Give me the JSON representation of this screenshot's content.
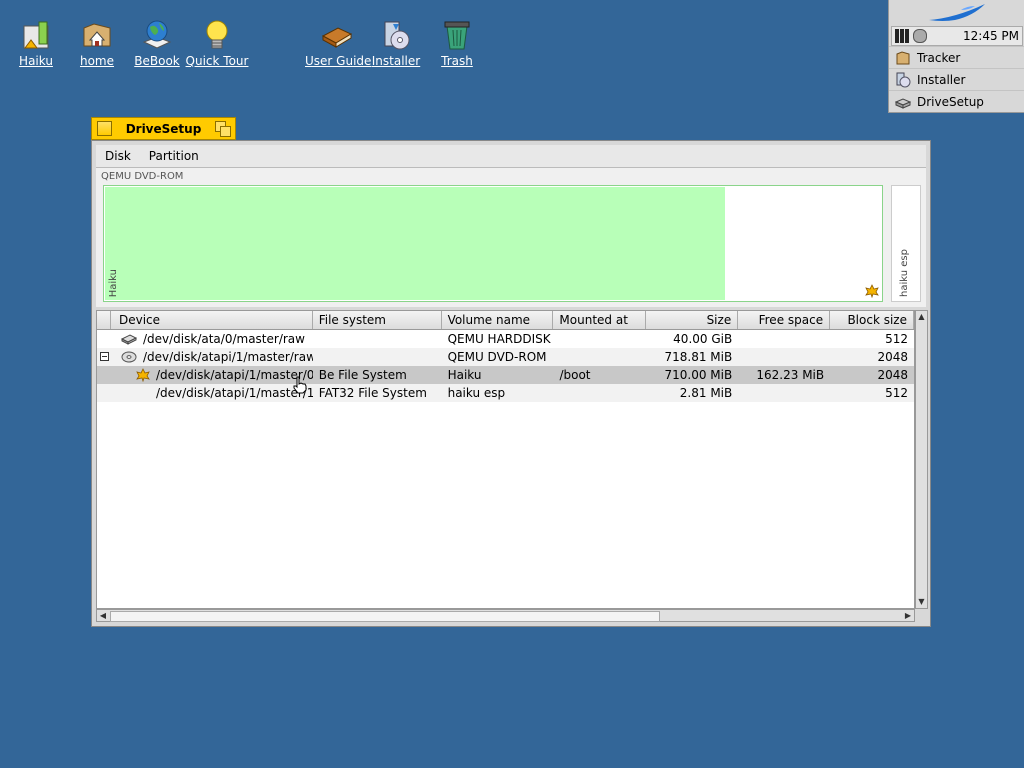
{
  "desktop": {
    "icons": [
      {
        "label": "Haiku",
        "icon": "haiku-volume-icon"
      },
      {
        "label": "home",
        "icon": "home-folder-icon"
      },
      {
        "label": "BeBook",
        "icon": "bebook-globe-icon"
      },
      {
        "label": "Quick Tour",
        "icon": "lightbulb-icon"
      },
      {
        "label": "User Guide",
        "icon": "book-icon"
      },
      {
        "label": "Installer",
        "icon": "installer-icon"
      },
      {
        "label": "Trash",
        "icon": "trash-icon"
      }
    ]
  },
  "deskbar": {
    "clock": "12:45 PM",
    "apps": [
      {
        "label": "Tracker",
        "icon": "tracker-icon"
      },
      {
        "label": "Installer",
        "icon": "installer-icon"
      },
      {
        "label": "DriveSetup",
        "icon": "drivesetup-icon"
      }
    ]
  },
  "window": {
    "title": "DriveSetup",
    "menu": [
      "Disk",
      "Partition"
    ],
    "disk_label": "QEMU DVD-ROM",
    "partitions": [
      {
        "label": "Haiku",
        "used_fraction": 0.8
      },
      {
        "label": "haiku esp"
      }
    ],
    "columns": [
      "Device",
      "File system",
      "Volume name",
      "Mounted at",
      "Size",
      "Free space",
      "Block size"
    ],
    "rows": [
      {
        "device": "/dev/disk/ata/0/master/raw",
        "fs": "",
        "volume": "QEMU HARDDISK",
        "mount": "",
        "size": "40.00 GiB",
        "free": "",
        "block": "512",
        "icon": "harddisk-icon"
      },
      {
        "device": "/dev/disk/atapi/1/master/raw",
        "fs": "",
        "volume": "QEMU DVD-ROM",
        "mount": "",
        "size": "718.81 MiB",
        "free": "",
        "block": "2048",
        "icon": "cdrom-icon"
      },
      {
        "device": "/dev/disk/atapi/1/master/0",
        "fs": "Be File System",
        "volume": "Haiku",
        "mount": "/boot",
        "size": "710.00 MiB",
        "free": "162.23 MiB",
        "block": "2048",
        "icon": "haiku-leaf-icon"
      },
      {
        "device": "/dev/disk/atapi/1/master/1",
        "fs": "FAT32 File System",
        "volume": "haiku esp",
        "mount": "",
        "size": "2.81 MiB",
        "free": "",
        "block": "512",
        "icon": ""
      }
    ]
  },
  "colors": {
    "desktop": "#336698",
    "tab": "#ffcb00",
    "partition_used": "#b8ffb8",
    "selection": "#c8c8c8"
  }
}
